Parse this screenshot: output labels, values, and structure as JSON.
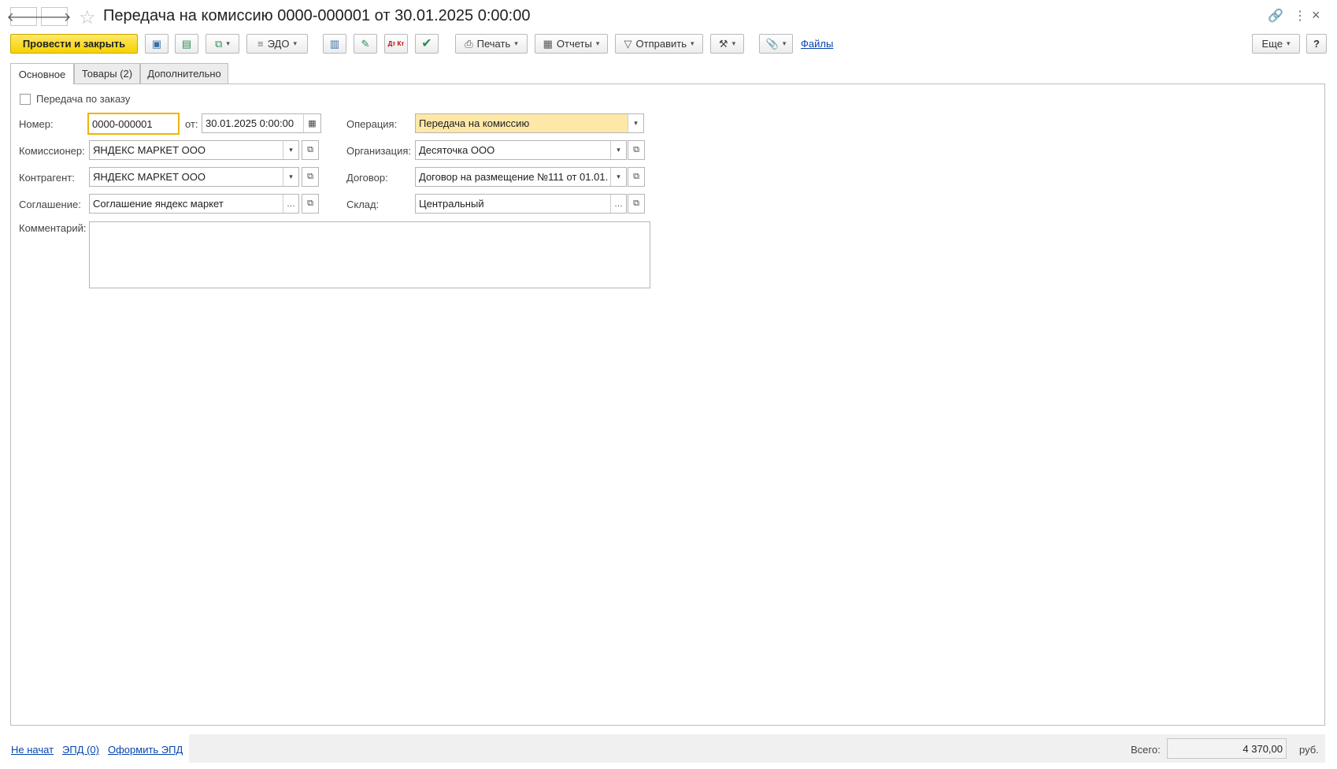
{
  "window": {
    "title": "Передача на комиссию 0000-000001 от 30.01.2025 0:00:00",
    "back_icon": "arrow-left-icon",
    "forward_icon": "arrow-right-icon",
    "favorite_icon": "star-icon",
    "link_icon": "link-icon",
    "menu_icon": "more-vert-icon",
    "close_icon": "close-icon"
  },
  "toolbar": {
    "post_close_label": "Провести и закрыть",
    "edo_label": "ЭДО",
    "print_label": "Печать",
    "reports_label": "Отчеты",
    "send_label": "Отправить",
    "files_label": "Файлы",
    "more_label": "Еще",
    "help_label": "?",
    "dt_kt_label": "Дт Кт"
  },
  "tabs": [
    {
      "label": "Основное",
      "active": true
    },
    {
      "label": "Товары (2)",
      "active": false
    },
    {
      "label": "Дополнительно",
      "active": false
    }
  ],
  "form": {
    "by_order_label": "Передача по заказу",
    "by_order_checked": false,
    "number_label": "Номер:",
    "number_value": "0000-000001",
    "date_label": "от:",
    "date_value": "30.01.2025  0:00:00",
    "operation_label": "Операция:",
    "operation_value": "Передача на комиссию",
    "commissioner_label": "Комиссионер:",
    "commissioner_value": "ЯНДЕКС МАРКЕТ ООО",
    "organization_label": "Организация:",
    "organization_value": "Десяточка ООО",
    "counterparty_label": "Контрагент:",
    "counterparty_value": "ЯНДЕКС МАРКЕТ ООО",
    "contract_label": "Договор:",
    "contract_value": "Договор на размещение №111 от 01.01.",
    "agreement_label": "Соглашение:",
    "agreement_value": "Соглашение яндекс маркет",
    "warehouse_label": "Склад:",
    "warehouse_value": "Центральный",
    "comment_label": "Комментарий:",
    "comment_value": ""
  },
  "footer": {
    "status_link": "Не начат",
    "epd_link": "ЭПД (0)",
    "make_epd_link": "Оформить ЭПД",
    "total_label": "Всего:",
    "total_value": "4 370,00",
    "currency": "руб."
  },
  "colors": {
    "primary_button": "#f6d200",
    "operation_bg": "#fde8a8",
    "active_field_border": "#f0b400",
    "link": "#0645ad"
  }
}
